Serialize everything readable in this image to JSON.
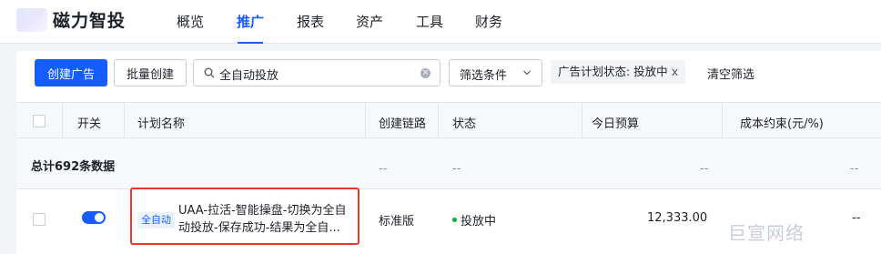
{
  "brand": {
    "name": "磁力智投"
  },
  "nav": {
    "items": [
      {
        "label": "概览"
      },
      {
        "label": "推广",
        "active": true
      },
      {
        "label": "报表"
      },
      {
        "label": "资产"
      },
      {
        "label": "工具"
      },
      {
        "label": "财务"
      }
    ]
  },
  "toolbar": {
    "create_label": "创建广告",
    "batch_label": "批量创建",
    "search_value": "全自动投放",
    "filter_label": "筛选条件",
    "filter_tag_label": "广告计划状态: 投放中",
    "filter_tag_close": "x",
    "clear_filter_label": "清空筛选"
  },
  "table": {
    "headers": {
      "switch": "开关",
      "plan_name": "计划名称",
      "create_link": "创建链路",
      "status": "状态",
      "today_budget": "今日预算",
      "cost_constraint": "成本约束(元/%)"
    },
    "total_label": "总计692条数据",
    "total_dash": "--",
    "rows": [
      {
        "switch_on": true,
        "tag": "全自动",
        "name_line1": "UAA-拉活-智能操盘-切换为全自",
        "name_line2": "动投放-保存成功-结果为全自...",
        "create_link": "标准版",
        "status": "投放中",
        "budget": "12,333.00",
        "cost_constraint": "--"
      }
    ]
  },
  "watermark": "巨宣网络",
  "colors": {
    "primary": "#165dff",
    "highlight_border": "#e8372d",
    "status_running": "#00b42a"
  }
}
